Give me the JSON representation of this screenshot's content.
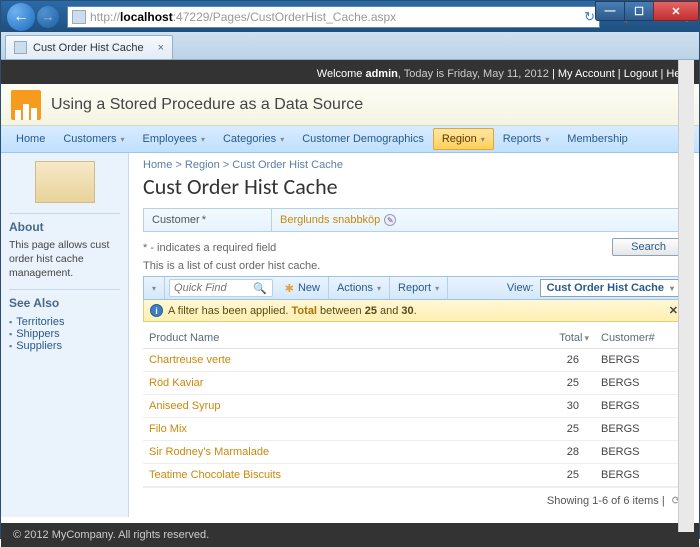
{
  "browser": {
    "url_prefix": "http://",
    "url_host": "localhost",
    "url_port_path": ":47229/Pages/CustOrderHist_Cache.aspx",
    "tab_title": "Cust Order Hist Cache"
  },
  "welcome": {
    "text_prefix": "Welcome ",
    "user": "admin",
    "date_text": ", Today is Friday, May 11, 2012",
    "links": {
      "account": "My Account",
      "logout": "Logout",
      "help": "Help"
    }
  },
  "banner": {
    "title": "Using a Stored Procedure as a Data Source"
  },
  "menu": [
    {
      "label": "Home",
      "dropdown": false
    },
    {
      "label": "Customers",
      "dropdown": true
    },
    {
      "label": "Employees",
      "dropdown": true
    },
    {
      "label": "Categories",
      "dropdown": true
    },
    {
      "label": "Customer Demographics",
      "dropdown": false
    },
    {
      "label": "Region",
      "dropdown": true,
      "active": true
    },
    {
      "label": "Reports",
      "dropdown": true
    },
    {
      "label": "Membership",
      "dropdown": false
    }
  ],
  "sidebar": {
    "about_h": "About",
    "about_p": "This page allows cust order hist cache management.",
    "see_also_h": "See Also",
    "links": [
      "Territories",
      "Shippers",
      "Suppliers"
    ]
  },
  "breadcrumb": {
    "a": "Home",
    "b": "Region",
    "c": "Cust Order Hist Cache"
  },
  "page_title": "Cust Order Hist Cache",
  "form": {
    "label": "Customer",
    "value": "Berglunds snabbköp"
  },
  "required_note": "* - indicates a required field",
  "search_label": "Search",
  "list_note": "This is a list of cust order hist cache.",
  "toolbar": {
    "quickfind_placeholder": "Quick Find",
    "new": "New",
    "actions": "Actions",
    "report": "Report",
    "view_label": "View:",
    "view_value": "Cust Order Hist Cache"
  },
  "filter": {
    "prefix": "A filter has been applied. ",
    "field": "Total",
    "mid": " between ",
    "v1": "25",
    "and": " and ",
    "v2": "30",
    "suffix": "."
  },
  "columns": {
    "product": "Product Name",
    "total": "Total",
    "customer": "Customer#"
  },
  "rows": [
    {
      "product": "Chartreuse verte",
      "total": 26,
      "customer": "BERGS"
    },
    {
      "product": "Röd Kaviar",
      "total": 25,
      "customer": "BERGS"
    },
    {
      "product": "Aniseed Syrup",
      "total": 30,
      "customer": "BERGS"
    },
    {
      "product": "Filo Mix",
      "total": 25,
      "customer": "BERGS"
    },
    {
      "product": "Sir Rodney's Marmalade",
      "total": 28,
      "customer": "BERGS"
    },
    {
      "product": "Teatime Chocolate Biscuits",
      "total": 25,
      "customer": "BERGS"
    }
  ],
  "pager": {
    "text": "Showing 1-6 of 6 items"
  },
  "footer": {
    "text": "© 2012 MyCompany. All rights reserved."
  }
}
